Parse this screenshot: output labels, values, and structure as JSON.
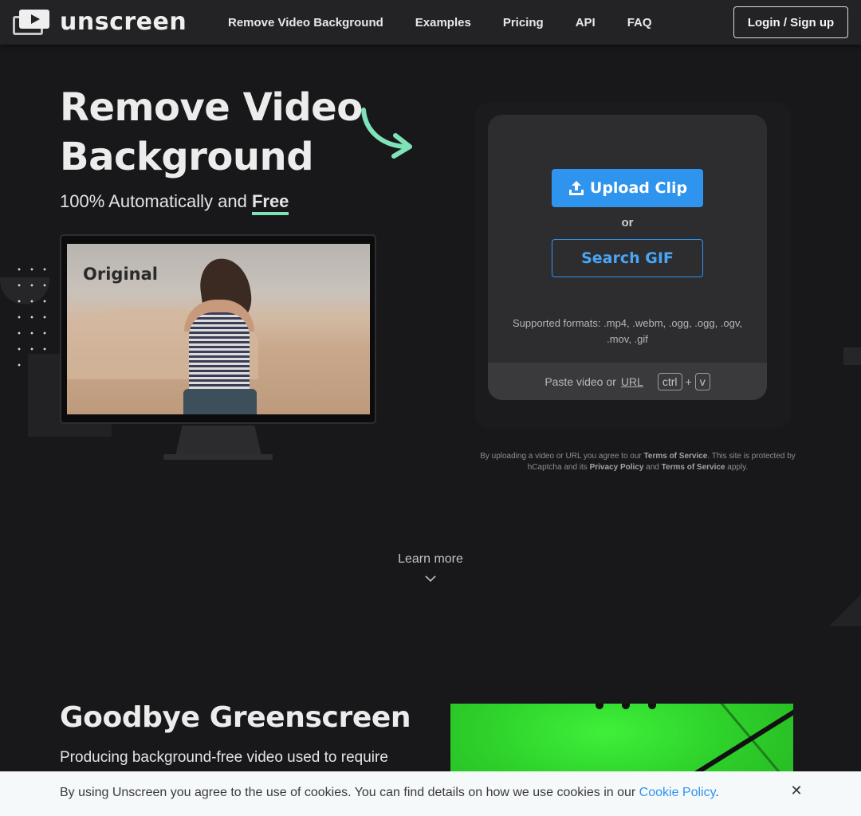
{
  "header": {
    "logo_text": "unscreen",
    "nav": [
      {
        "label": "Remove Video Background"
      },
      {
        "label": "Examples"
      },
      {
        "label": "Pricing"
      },
      {
        "label": "API"
      },
      {
        "label": "FAQ"
      }
    ],
    "login_label": "Login / Sign up"
  },
  "hero": {
    "title_line1": "Remove Video",
    "title_line2": "Background",
    "subtitle_prefix": "100% Automatically and ",
    "subtitle_free": "Free",
    "monitor_label": "Original"
  },
  "upload": {
    "upload_label": "Upload Clip",
    "or_label": "or",
    "search_gif_label": "Search GIF",
    "formats_line1": "Supported formats: .mp4, .webm, .ogg, .ogg, .ogv,",
    "formats_line2": ".mov, .gif",
    "paste_prefix": "Paste video or",
    "paste_url": "URL",
    "key_ctrl": "ctrl",
    "key_plus": "+",
    "key_v": "v"
  },
  "terms": {
    "t1": "By uploading a video or URL you agree to our ",
    "tos1": "Terms of Service",
    "t2": ". This site is protected by hCaptcha and its ",
    "privacy": "Privacy Policy",
    "t3": " and ",
    "tos2": "Terms of Service",
    "t4": " apply."
  },
  "learn_more": "Learn more",
  "goodbye": {
    "title": "Goodbye Greenscreen",
    "text": "Producing background-free video used to require"
  },
  "cookie": {
    "text": "By using Unscreen you agree to the use of cookies. You can find details on how we use cookies in our ",
    "link": "Cookie Policy",
    "end": ".",
    "close": "✕"
  },
  "colors": {
    "accent_blue": "#2f94ee",
    "accent_green": "#7fe3b9",
    "background": "#18181a"
  },
  "icons": [
    "logo-icon",
    "upload-icon",
    "arrow-icon",
    "chevron-down-icon",
    "close-icon"
  ]
}
